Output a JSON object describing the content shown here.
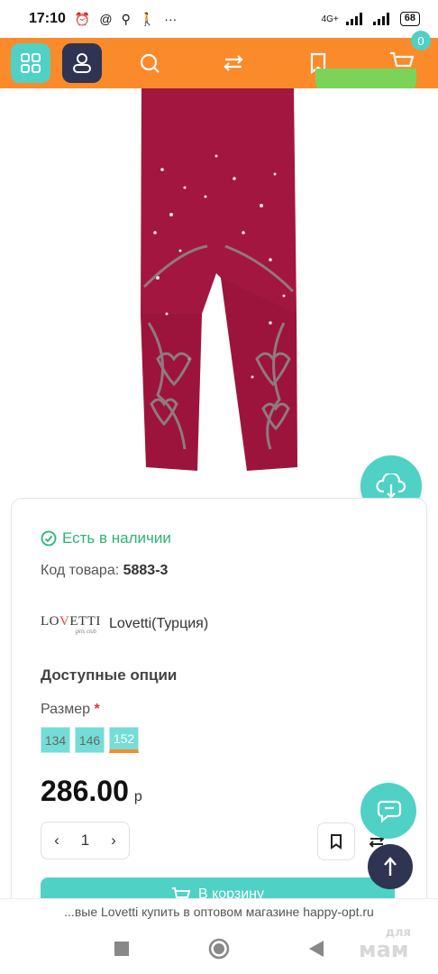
{
  "status_bar": {
    "time": "17:10",
    "network": "4G+",
    "battery": "68"
  },
  "app_bar": {
    "cart_count": "0",
    "accent_color": "#fb8a2b",
    "teal_color": "#4fd1c5"
  },
  "product": {
    "stock_status": "Есть в наличии",
    "sku_label": "Код товара:",
    "sku_value": "5883-3",
    "brand_logo_text": "LOVETTI",
    "brand_logo_sub": "girls club",
    "brand_name": "Lovetti(Турция)",
    "options_title": "Доступные опции",
    "size_label": "Размер",
    "size_required_mark": "*",
    "sizes": [
      "134",
      "146",
      "152"
    ],
    "selected_size": "152",
    "price": "286.00",
    "currency": "р",
    "quantity": "1",
    "qty_minus": "‹",
    "qty_plus": "›",
    "add_to_cart_label": "В корзину"
  },
  "browser": {
    "page_title": "...вые Lovetti купить в оптовом магазине happy-opt.ru"
  },
  "watermark": {
    "line1": "для",
    "line2": "мам"
  },
  "icons": {
    "grid": "grid-icon",
    "user": "user-icon",
    "search": "search-icon",
    "compare": "compare-icon",
    "bookmark": "bookmark-icon",
    "cart": "cart-icon",
    "cloud_download": "cloud-download-icon",
    "chat": "chat-icon",
    "arrow_up": "arrow-up-icon"
  }
}
